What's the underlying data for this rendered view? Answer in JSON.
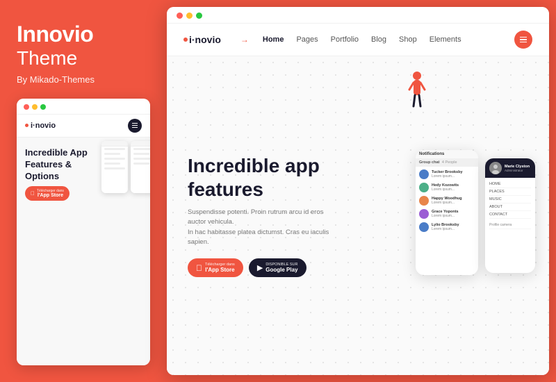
{
  "left": {
    "title_main": "Innovio",
    "title_sub": "Theme",
    "by": "By Mikado-Themes",
    "mini_browser": {
      "logo": "i·novio",
      "hero_title": "Incredible App Features & Options",
      "appstore_label_top": "Télécharger dans",
      "appstore_label": "l'App Store"
    }
  },
  "right": {
    "browser": {
      "nav": {
        "logo": "i·novio",
        "home": "Home",
        "pages": "Pages",
        "portfolio": "Portfolio",
        "blog": "Blog",
        "shop": "Shop",
        "elements": "Elements"
      },
      "hero": {
        "title_line1": "Incredible app",
        "title_line2": "features",
        "description": "Suspendisse potenti. Proin rutrum arcu id eros auctor vehicula.\nIn hac habitasse platea dictumst. Cras eu iaculis sapien.",
        "btn_appstore_top": "Télécharger dans",
        "btn_appstore_main": "l'App Store",
        "btn_google_top": "DISPONIBLE SUR",
        "btn_google_main": "Google Play"
      },
      "phone1": {
        "header": "Notifications",
        "section": "Group chat",
        "count": "4 People",
        "chats": [
          {
            "name": "Tucker Brooksby",
            "msg": "Lorem ipsum..."
          },
          {
            "name": "Hedy Kozowits",
            "msg": "Lorem ipsum..."
          },
          {
            "name": "Happy Woodhug",
            "msg": "Lorem ipsum..."
          },
          {
            "name": "Grace Yoponts",
            "msg": "Lorem ipsum..."
          },
          {
            "name": "Lylio Brooksby",
            "msg": "Lorem ipsum..."
          }
        ]
      },
      "phone2": {
        "profile_name": "Marie Clyston",
        "profile_role": "Administrator",
        "menu_items": [
          "HOME",
          "PLACES",
          "MUSIC",
          "ABOUT",
          "CONTACT"
        ],
        "profile_camera": "Profile camera"
      }
    }
  }
}
